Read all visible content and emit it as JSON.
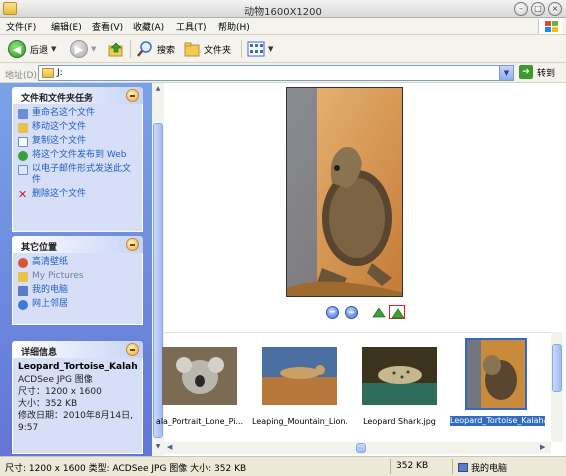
{
  "window": {
    "title": "动物1600X1200"
  },
  "menu": [
    "文件(F)",
    "编辑(E)",
    "查看(V)",
    "收藏(A)",
    "工具(T)",
    "帮助(H)"
  ],
  "toolbar": {
    "back": "后退",
    "search": "搜索",
    "folders": "文件夹"
  },
  "address": {
    "label": "地址(D)",
    "path": "J:",
    "go": "转到"
  },
  "tasks_panel": {
    "title": "文件和文件夹任务",
    "items": [
      {
        "label": "重命名这个文件",
        "icon": "rename-icon"
      },
      {
        "label": "移动这个文件",
        "icon": "move-icon"
      },
      {
        "label": "复制这个文件",
        "icon": "copy-icon"
      },
      {
        "label": "将这个文件发布到 Web",
        "icon": "web-publish-icon"
      },
      {
        "label": "以电子邮件形式发送此文件",
        "icon": "email-icon"
      },
      {
        "label": "删除这个文件",
        "icon": "delete-icon"
      }
    ]
  },
  "places_panel": {
    "title": "其它位置",
    "items": [
      {
        "label": "高清壁纸",
        "icon": "folder-icon"
      },
      {
        "label": "My Pictures",
        "icon": "pictures-folder-icon"
      },
      {
        "label": "我的电脑",
        "icon": "computer-icon"
      },
      {
        "label": "网上邻居",
        "icon": "network-icon"
      }
    ]
  },
  "details_panel": {
    "title": "详细信息",
    "filename": "Leopard_Tortoise_Kalaha",
    "type": "ACDSee JPG 图像",
    "size_dim": "尺寸：1200 x 1600",
    "filesize": "大小：352 KB",
    "modified_label": "修改日期：2010年8月14日,",
    "modified_time": "9:57"
  },
  "thumbnails": [
    {
      "label": "ala_Portrait_Lone_Pi...",
      "icon": "koala-photo"
    },
    {
      "label": "Leaping_Mountain_Lion...",
      "icon": "mountain-lion-photo"
    },
    {
      "label": "Leopard Shark.jpg",
      "icon": "leopard-shark-photo"
    },
    {
      "label": "Leopard_Tortoise_Kalahari_Desert.jpg",
      "icon": "tortoise-photo",
      "selected": true
    }
  ],
  "status": {
    "info": "尺寸: 1200 x 1600 类型: ACDSee JPG 图像 大小: 352 KB",
    "size": "352 KB",
    "location": "我的电脑"
  }
}
